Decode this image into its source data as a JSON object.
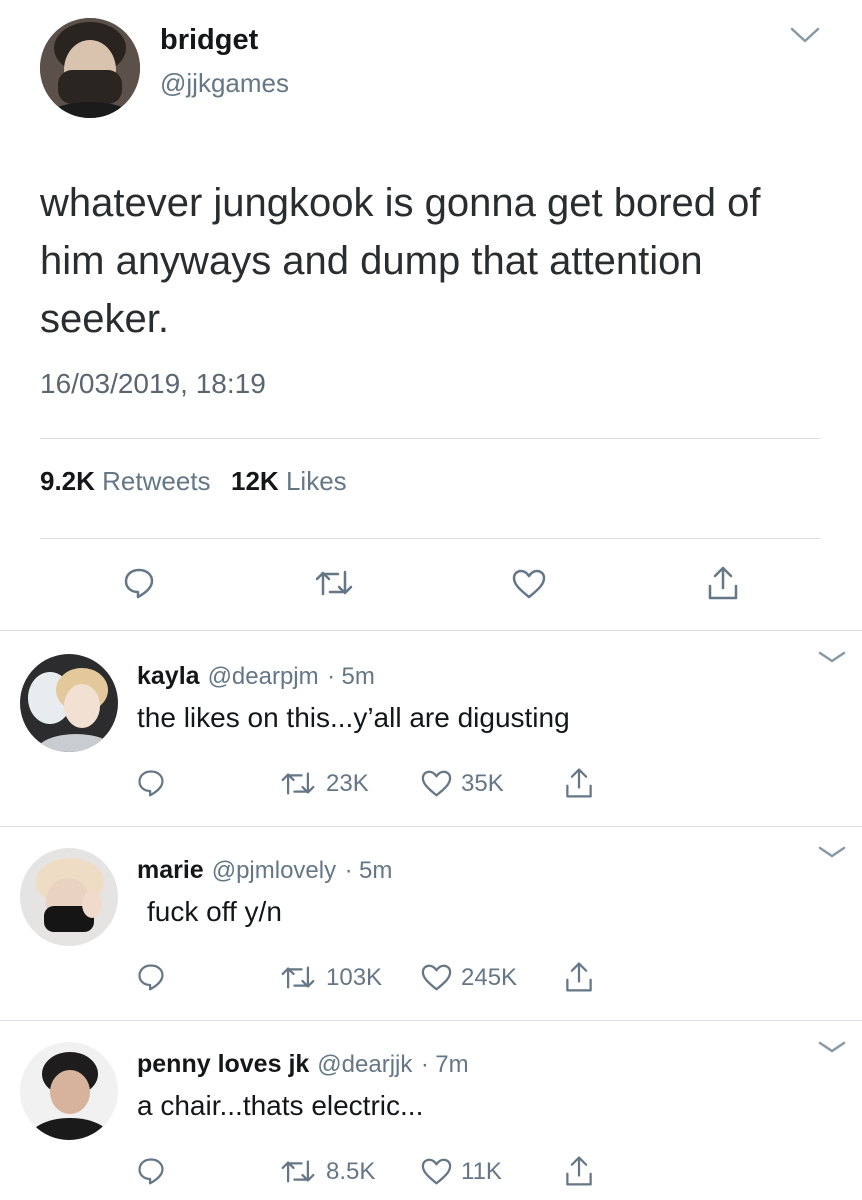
{
  "main_tweet": {
    "display_name": "bridget",
    "handle": "@jjkgames",
    "text": "whatever jungkook is gonna get bored of him anyways and dump that attention seeker.",
    "timestamp": "16/03/2019, 18:19",
    "retweet_count": "9.2K",
    "retweet_label": "Retweets",
    "like_count": "12K",
    "like_label": "Likes",
    "icons": [
      "reply-icon",
      "retweet-icon",
      "heart-icon",
      "share-icon",
      "chevron-down-icon"
    ]
  },
  "replies": [
    {
      "display_name": "kayla",
      "handle": "@dearpjm",
      "separator": "·",
      "time": "5m",
      "text": "the likes on this...y’all are digusting",
      "retweets": "23K",
      "likes": "35K"
    },
    {
      "display_name": "marie",
      "handle": "@pjmlovely",
      "separator": "·",
      "time": "5m",
      "text": "fuck off y/n",
      "retweets": "103K",
      "likes": "245K"
    },
    {
      "display_name": "penny loves jk",
      "handle": "@dearjjk",
      "separator": "·",
      "time": "7m",
      "text": "a chair...thats electric...",
      "retweets": "8.5K",
      "likes": "11K"
    }
  ],
  "colors": {
    "text": "#14171a",
    "secondary": "#657786",
    "divider": "#d9dde1",
    "icon": "#657786"
  }
}
